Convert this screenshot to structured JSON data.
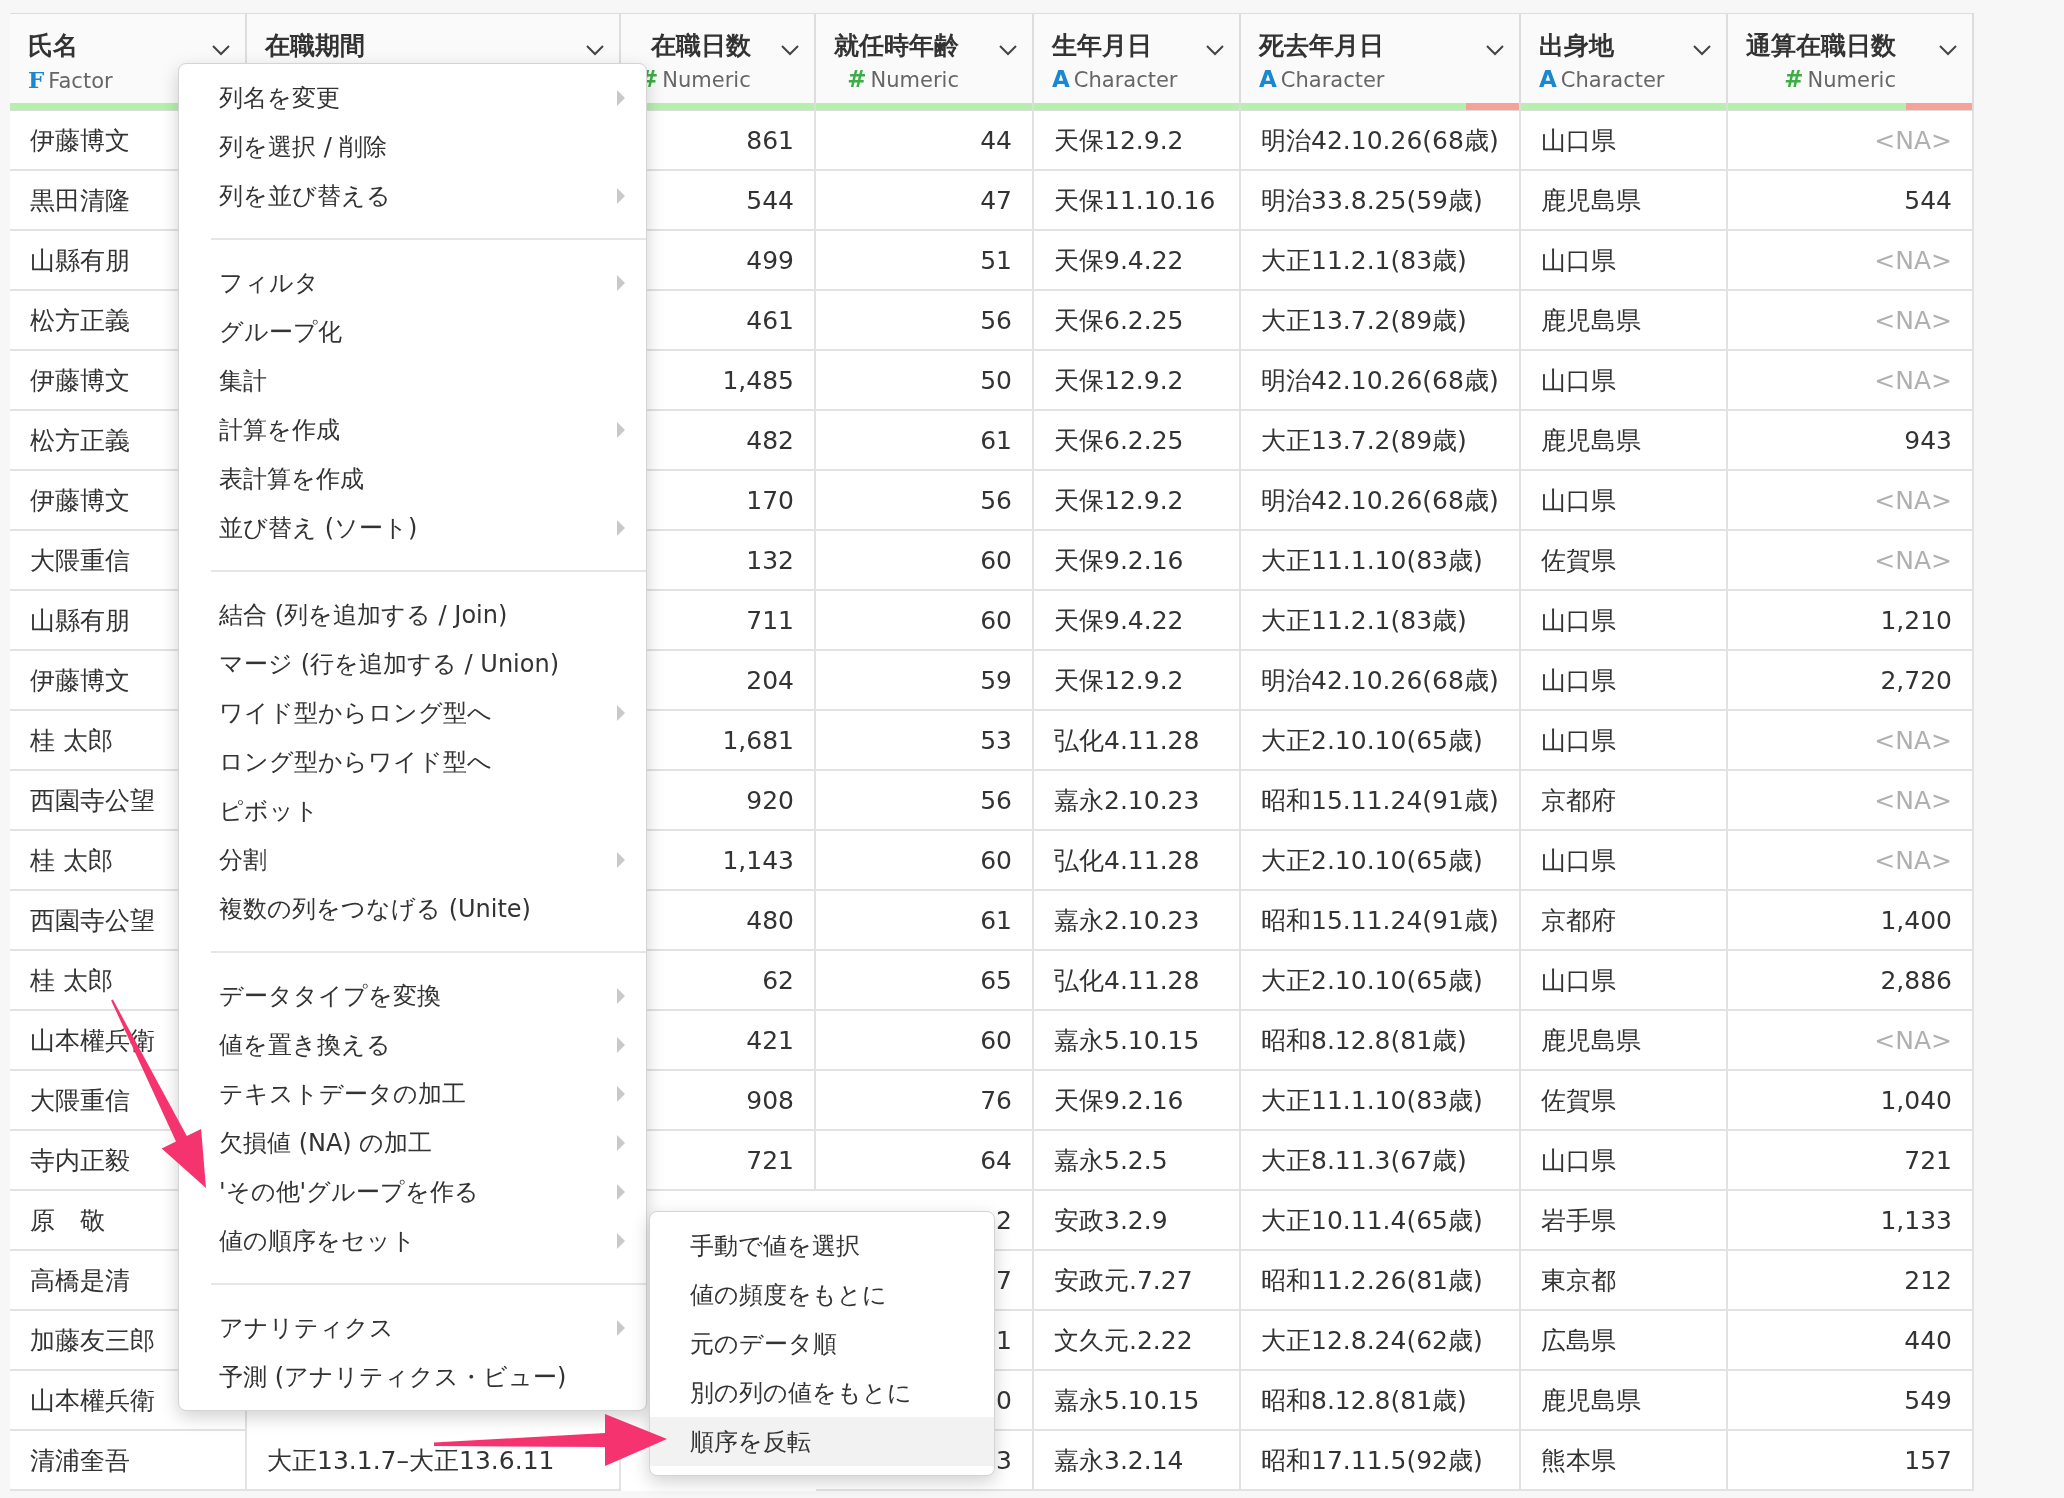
{
  "table": {
    "columns": [
      {
        "name": "氏名",
        "kind": "factor",
        "type_mark": "F",
        "type_label": "Factor",
        "level": 1
      },
      {
        "name": "在職期間"
      },
      {
        "name": "在職日数",
        "kind": "numeric",
        "type_mark": "#",
        "type_label": "Numeric",
        "level": 1
      },
      {
        "name": "就任時年齢",
        "kind": "numeric",
        "type_mark": "#",
        "type_label": "Numeric",
        "level": 1
      },
      {
        "name": "生年月日",
        "kind": "character",
        "type_mark": "A",
        "type_label": "Character",
        "level": 1
      },
      {
        "name": "死去年月日",
        "kind": "character",
        "type_mark": "A",
        "type_label": "Character",
        "level": 0.81
      },
      {
        "name": "出身地",
        "kind": "character",
        "type_mark": "A",
        "type_label": "Character",
        "level": 1
      },
      {
        "name": "通算在職日数",
        "kind": "numeric",
        "type_mark": "#",
        "type_label": "Numeric",
        "level": 0.73
      }
    ],
    "rows": [
      [
        "伊藤博文",
        null,
        "861",
        "44",
        "天保12.9.2",
        "明治42.10.26(68歳)",
        "山口県",
        {
          "text": "<NA>",
          "na": true
        }
      ],
      [
        "黒田清隆",
        null,
        "544",
        "47",
        "天保11.10.16",
        "明治33.8.25(59歳)",
        "鹿児島県",
        "544"
      ],
      [
        "山縣有朋",
        null,
        "499",
        "51",
        "天保9.4.22",
        "大正11.2.1(83歳)",
        "山口県",
        {
          "text": "<NA>",
          "na": true
        }
      ],
      [
        "松方正義",
        null,
        "461",
        "56",
        "天保6.2.25",
        "大正13.7.2(89歳)",
        "鹿児島県",
        {
          "text": "<NA>",
          "na": true
        }
      ],
      [
        "伊藤博文",
        null,
        "1,485",
        "50",
        "天保12.9.2",
        "明治42.10.26(68歳)",
        "山口県",
        {
          "text": "<NA>",
          "na": true
        }
      ],
      [
        "松方正義",
        null,
        "482",
        "61",
        "天保6.2.25",
        "大正13.7.2(89歳)",
        "鹿児島県",
        "943"
      ],
      [
        "伊藤博文",
        null,
        "170",
        "56",
        "天保12.9.2",
        "明治42.10.26(68歳)",
        "山口県",
        {
          "text": "<NA>",
          "na": true
        }
      ],
      [
        "大隈重信",
        null,
        "132",
        "60",
        "天保9.2.16",
        "大正11.1.10(83歳)",
        "佐賀県",
        {
          "text": "<NA>",
          "na": true
        }
      ],
      [
        "山縣有朋",
        null,
        "711",
        "60",
        "天保9.4.22",
        "大正11.2.1(83歳)",
        "山口県",
        "1,210"
      ],
      [
        "伊藤博文",
        null,
        "204",
        "59",
        "天保12.9.2",
        "明治42.10.26(68歳)",
        "山口県",
        "2,720"
      ],
      [
        "桂 太郎",
        null,
        "1,681",
        "53",
        "弘化4.11.28",
        "大正2.10.10(65歳)",
        "山口県",
        {
          "text": "<NA>",
          "na": true
        }
      ],
      [
        "西園寺公望",
        null,
        "920",
        "56",
        "嘉永2.10.23",
        "昭和15.11.24(91歳)",
        "京都府",
        {
          "text": "<NA>",
          "na": true
        }
      ],
      [
        "桂 太郎",
        null,
        "1,143",
        "60",
        "弘化4.11.28",
        "大正2.10.10(65歳)",
        "山口県",
        {
          "text": "<NA>",
          "na": true
        }
      ],
      [
        "西園寺公望",
        null,
        "480",
        "61",
        "嘉永2.10.23",
        "昭和15.11.24(91歳)",
        "京都府",
        "1,400"
      ],
      [
        "桂 太郎",
        null,
        "62",
        "65",
        "弘化4.11.28",
        "大正2.10.10(65歳)",
        "山口県",
        "2,886"
      ],
      [
        "山本權兵衛",
        null,
        "421",
        "60",
        "嘉永5.10.15",
        "昭和8.12.8(81歳)",
        "鹿児島県",
        {
          "text": "<NA>",
          "na": true
        }
      ],
      [
        "大隈重信",
        null,
        "908",
        "76",
        "天保9.2.16",
        "大正11.1.10(83歳)",
        "佐賀県",
        "1,040"
      ],
      [
        "寺内正毅",
        null,
        "721",
        "64",
        "嘉永5.2.5",
        "大正8.11.3(67歳)",
        "山口県",
        "721"
      ],
      [
        "原　敬",
        null,
        null,
        "2",
        "安政3.2.9",
        "大正10.11.4(65歳)",
        "岩手県",
        "1,133"
      ],
      [
        "高橋是清",
        null,
        null,
        "7",
        "安政元.7.27",
        "昭和11.2.26(81歳)",
        "東京都",
        "212"
      ],
      [
        "加藤友三郎",
        null,
        null,
        "1",
        "文久元.2.22",
        "大正12.8.24(62歳)",
        "広島県",
        "440"
      ],
      [
        "山本權兵衛",
        null,
        null,
        "0",
        "嘉永5.10.15",
        "昭和8.12.8(81歳)",
        "鹿児島県",
        "549"
      ],
      [
        "清浦奎吾",
        "大正13.1.7–大正13.6.11",
        null,
        "3",
        "嘉永3.2.14",
        "昭和17.11.5(92歳)",
        "熊本県",
        "157"
      ]
    ]
  },
  "context_menu": {
    "sections": [
      [
        {
          "label": "列名を変更",
          "submenu": true
        },
        {
          "label": "列を選択 / 削除",
          "submenu": false
        },
        {
          "label": "列を並び替える",
          "submenu": true
        }
      ],
      [
        {
          "label": "フィルタ",
          "submenu": true
        },
        {
          "label": "グループ化",
          "submenu": false
        },
        {
          "label": "集計",
          "submenu": false
        },
        {
          "label": "計算を作成",
          "submenu": true
        },
        {
          "label": "表計算を作成",
          "submenu": false
        },
        {
          "label": "並び替え (ソート)",
          "submenu": true
        }
      ],
      [
        {
          "label": "結合 (列を追加する / Join)",
          "submenu": false
        },
        {
          "label": "マージ (行を追加する / Union)",
          "submenu": false
        },
        {
          "label": "ワイド型からロング型へ",
          "submenu": true
        },
        {
          "label": "ロング型からワイド型へ",
          "submenu": false
        },
        {
          "label": "ピボット",
          "submenu": false
        },
        {
          "label": "分割",
          "submenu": true
        },
        {
          "label": "複数の列をつなげる (Unite)",
          "submenu": false
        }
      ],
      [
        {
          "label": "データタイプを変換",
          "submenu": true
        },
        {
          "label": "値を置き換える",
          "submenu": true
        },
        {
          "label": "テキストデータの加工",
          "submenu": true
        },
        {
          "label": "欠損値 (NA) の加工",
          "submenu": true
        },
        {
          "label": "'その他'グループを作る",
          "submenu": true
        },
        {
          "label": "値の順序をセット",
          "submenu": true
        }
      ],
      [
        {
          "label": "アナリティクス",
          "submenu": true
        },
        {
          "label": "予測 (アナリティクス・ビュー)",
          "submenu": false
        }
      ]
    ]
  },
  "submenu": {
    "items": [
      {
        "label": "手動で値を選択",
        "selected": false
      },
      {
        "label": "値の頻度をもとに",
        "selected": false
      },
      {
        "label": "元のデータ順",
        "selected": false
      },
      {
        "label": "別の列の値をもとに",
        "selected": false
      },
      {
        "label": "順序を反転",
        "selected": true
      }
    ]
  }
}
